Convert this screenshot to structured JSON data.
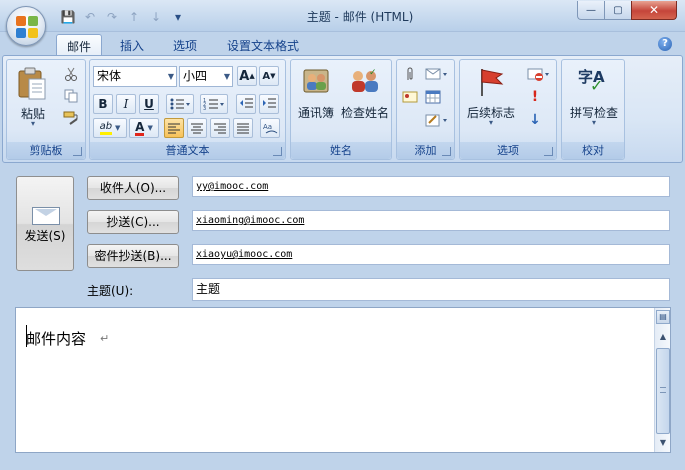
{
  "window": {
    "title": "主题 - 邮件 (HTML)",
    "min_glyph": "—",
    "max_glyph": "▢",
    "close_glyph": "✕"
  },
  "qat": {
    "save_icon": "💾",
    "undo_icon": "↶",
    "redo_icon": "↷",
    "up_icon": "↑",
    "down_icon": "↓",
    "customize_icon": "▾"
  },
  "tabs": [
    {
      "label": "邮件",
      "active": true
    },
    {
      "label": "插入",
      "active": false
    },
    {
      "label": "选项",
      "active": false
    },
    {
      "label": "设置文本格式",
      "active": false
    }
  ],
  "help": {
    "glyph": "?"
  },
  "ribbon": {
    "clipboard": {
      "label": "剪贴板",
      "paste_label": "粘贴",
      "paste_dropdown": "▾"
    },
    "font": {
      "label": "普通文本",
      "font_name": "宋体",
      "font_size": "小四",
      "grow": "A",
      "shrink": "A",
      "bold": "B",
      "italic": "I",
      "underline": "U",
      "highlight": "ab",
      "font_color": "A"
    },
    "names": {
      "label": "姓名",
      "address_book": "通讯簿",
      "check_names": "检查姓名"
    },
    "include": {
      "label": "添加"
    },
    "options": {
      "label": "选项",
      "follow_up": "后续标志"
    },
    "proofing": {
      "label": "校对",
      "spelling": "拼写检查",
      "spelling_glyph": "字A"
    }
  },
  "header": {
    "send_label": "发送(S)",
    "to_button": "收件人(O)...",
    "cc_button": "抄送(C)...",
    "bcc_button": "密件抄送(B)...",
    "to_value": "yy@imooc.com",
    "cc_value": "xiaoming@imooc.com",
    "bcc_value": "xiaoyu@imooc.com",
    "subject_label": "主题(U):",
    "subject_value": "主题"
  },
  "body": {
    "text": "邮件内容",
    "para_mark": "↵"
  },
  "colors": {
    "accent": "#15428b",
    "ribbon_bg": "#dde8f6",
    "close_red": "#c5453a",
    "highlight_yellow": "#ffef00",
    "font_red": "#e0261b"
  }
}
